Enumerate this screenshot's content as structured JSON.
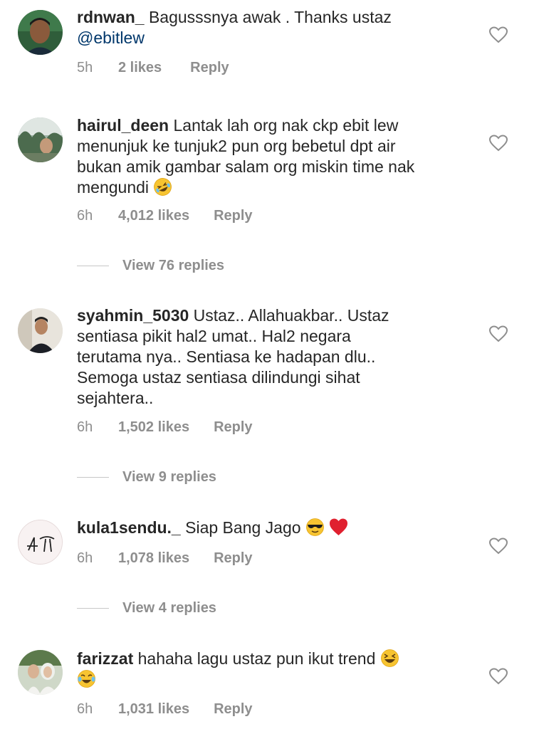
{
  "comments": [
    {
      "username": "rdnwan_",
      "text": " Bagusssnya awak . Thanks ustaz",
      "mention": "@ebitlew",
      "time": "5h",
      "likes": "2 likes",
      "reply": "Reply"
    },
    {
      "username": "hairul_deen",
      "text_line1": " Lantak lah org nak ckp ebit lew",
      "text_line2": "menunjuk ke tunjuk2 pun org bebetul dpt air",
      "text_line3": "bukan amik gambar salam org miskin time nak",
      "text_line4": "mengundi",
      "emoji": "rofl-emoji",
      "time": "6h",
      "likes": "4,012 likes",
      "reply": "Reply",
      "view_replies": "View 76 replies"
    },
    {
      "username": "syahmin_5030",
      "text_line1": " Ustaz.. Allahuakbar.. Ustaz",
      "text_line2": "sentiasa pikit hal2 umat.. Hal2 negara",
      "text_line3": "terutama nya.. Sentiasa ke hadapan dlu..",
      "text_line4": "Semoga ustaz sentiasa dilindungi sihat",
      "text_line5": "sejahtera..",
      "time": "6h",
      "likes": "1,502 likes",
      "reply": "Reply",
      "view_replies": "View 9 replies"
    },
    {
      "username": "kula1sendu._",
      "text": " Siap Bang Jago",
      "emojis": [
        "sunglasses-emoji",
        "red-heart-emoji"
      ],
      "time": "6h",
      "likes": "1,078 likes",
      "reply": "Reply",
      "view_replies": "View 4 replies"
    },
    {
      "username": "farizzat",
      "text": " hahaha lagu ustaz pun ikut trend",
      "emojis": [
        "laughing-emoji",
        "tears-of-joy-emoji"
      ],
      "time": "6h",
      "likes": "1,031 likes",
      "reply": "Reply"
    }
  ],
  "colors": {
    "text": "#262626",
    "meta": "#8e8e8e",
    "mention": "#00376b",
    "divider": "#c7c7c7"
  },
  "icons": {
    "like": "heart-outline-icon"
  }
}
